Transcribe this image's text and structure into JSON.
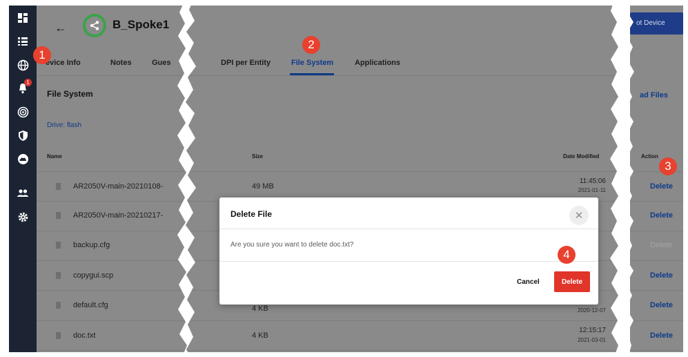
{
  "header": {
    "back_icon": "arrow-left-icon",
    "device_name": "B_Spoke1",
    "top_right_button": "ot Device",
    "accent": "#0e3a8a",
    "logo_color": "#3aa34a"
  },
  "sidebar": {
    "items": [
      {
        "icon": "dashboard-icon"
      },
      {
        "icon": "list-icon"
      },
      {
        "icon": "globe-icon"
      },
      {
        "icon": "bell-icon",
        "badge": "1"
      },
      {
        "icon": "radar-icon"
      },
      {
        "icon": "shield-icon"
      },
      {
        "icon": "cloud-icon"
      },
      {
        "icon": "users-icon"
      },
      {
        "icon": "gear-icon"
      }
    ]
  },
  "tabs": {
    "left": [
      {
        "label": "evice Info"
      },
      {
        "label": "Notes"
      },
      {
        "label": "Gues"
      }
    ],
    "right": [
      {
        "label": "DPI per Entity"
      },
      {
        "label": "File System",
        "active": true
      },
      {
        "label": "Applications"
      }
    ]
  },
  "section": {
    "title": "File System",
    "drive_label": "Drive: flash",
    "upload_label": "ad Files"
  },
  "table": {
    "columns": {
      "name": "Name",
      "size": "Size",
      "date": "Date Modified",
      "action": "Action"
    },
    "rows": [
      {
        "name": "AR2050V-main-20210108-",
        "size": "49 MB",
        "time": "11:45:06",
        "date": "2021-01-11",
        "action": "Delete"
      },
      {
        "name": "AR2050V-main-20210217-",
        "size": "",
        "time": "",
        "date": "",
        "action": "Delete"
      },
      {
        "name": "backup.cfg",
        "size": "",
        "time": "",
        "date": "",
        "action": "Delete",
        "disabled": true
      },
      {
        "name": "copygui.scp",
        "size": "",
        "time": "",
        "date": "",
        "action": "Delete"
      },
      {
        "name": "default.cfg",
        "size": "4 KB",
        "time": "",
        "date": "2020-12-07",
        "action": "Delete"
      },
      {
        "name": "doc.txt",
        "size": "4 KB",
        "time": "12:15:17",
        "date": "2021-03-01",
        "action": "Delete"
      }
    ]
  },
  "modal": {
    "title": "Delete File",
    "close_icon": "close-icon",
    "message": "Are you sure you want to delete doc.txt?",
    "cancel_label": "Cancel",
    "delete_label": "Delete",
    "delete_color": "#e1352a"
  },
  "callouts": [
    "1",
    "2",
    "3",
    "4"
  ]
}
